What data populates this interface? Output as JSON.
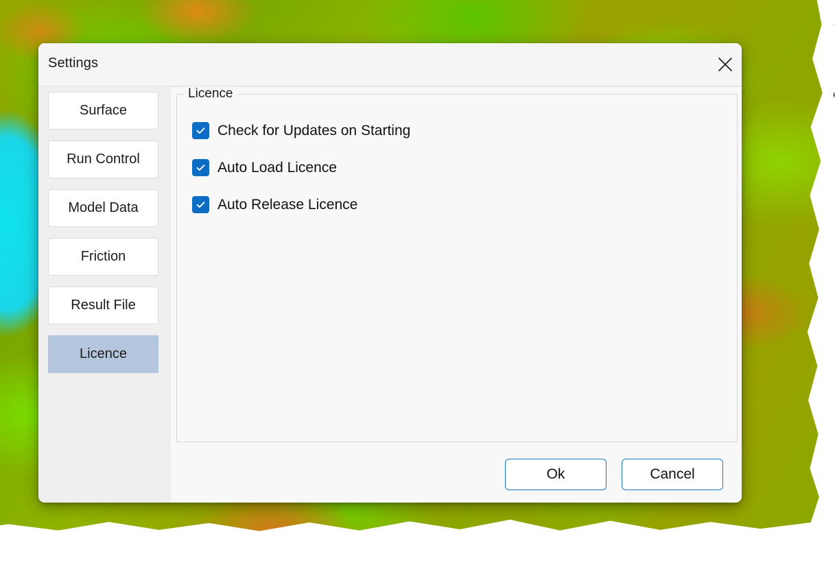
{
  "background": {
    "name": "terrain-elevation-raster",
    "colors": {
      "water": "#1ad6e8",
      "low": "#7ade00",
      "mid": "#9aa800",
      "high": "#d4781a",
      "outline": "#000000",
      "canvas": "#ffffff"
    }
  },
  "dialog": {
    "title": "Settings",
    "close_icon": "close-icon",
    "colors": {
      "titlebar": "#f5f5f5",
      "body": "#efefef",
      "panel": "#f8f8f8",
      "accent": "#0d6cc4",
      "selected": "#b3c6de",
      "button_border": "#1878c8"
    }
  },
  "sidebar": {
    "items": [
      {
        "label": "Surface",
        "selected": false
      },
      {
        "label": "Run Control",
        "selected": false
      },
      {
        "label": "Model Data",
        "selected": false
      },
      {
        "label": "Friction",
        "selected": false
      },
      {
        "label": "Result File",
        "selected": false
      },
      {
        "label": "Licence",
        "selected": true
      }
    ]
  },
  "groupbox": {
    "label": "Licence",
    "options": [
      {
        "label": "Check for Updates on Starting",
        "checked": true
      },
      {
        "label": "Auto Load Licence",
        "checked": true
      },
      {
        "label": "Auto Release Licence",
        "checked": true
      }
    ]
  },
  "footer": {
    "ok_label": "Ok",
    "cancel_label": "Cancel"
  }
}
